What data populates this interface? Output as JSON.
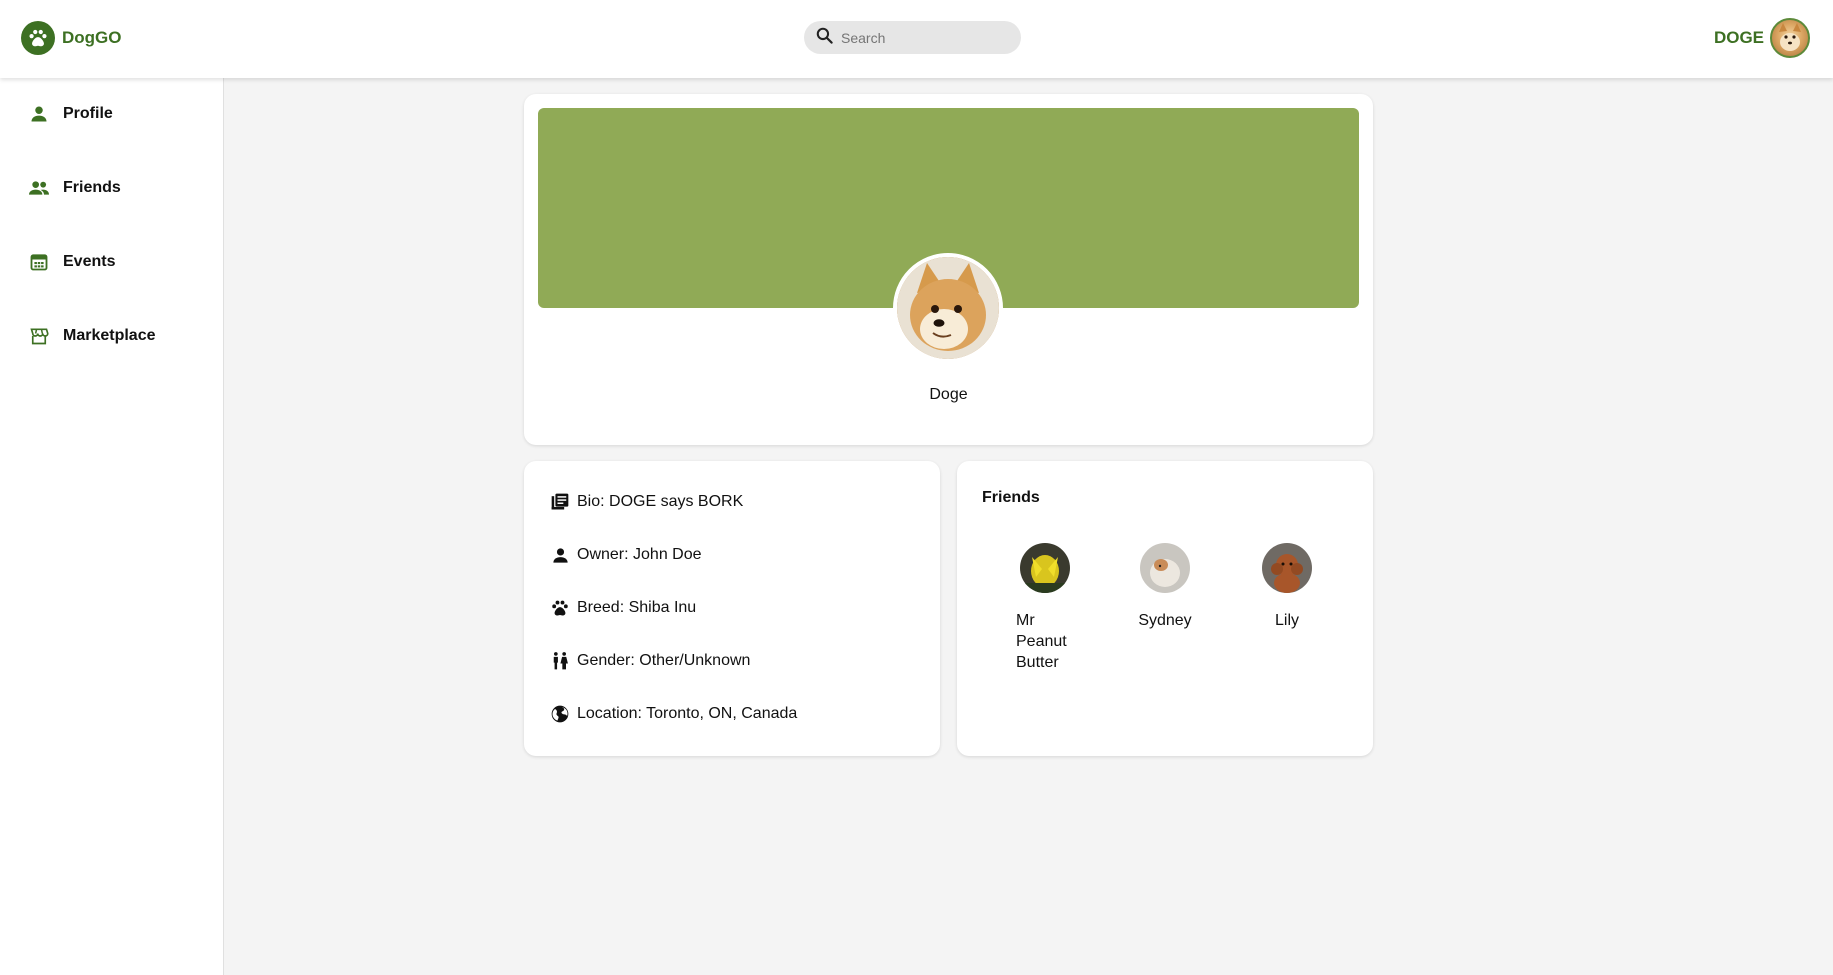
{
  "header": {
    "logo_text": "DogGO",
    "search_placeholder": "Search",
    "user_name": "DOGE"
  },
  "sidebar": {
    "items": [
      {
        "label": "Profile",
        "icon": "person-icon"
      },
      {
        "label": "Friends",
        "icon": "group-icon"
      },
      {
        "label": "Events",
        "icon": "calendar-icon"
      },
      {
        "label": "Marketplace",
        "icon": "storefront-icon"
      }
    ]
  },
  "profile": {
    "name": "Doge",
    "banner_color": "#90aa56"
  },
  "info": {
    "bio": "Bio: DOGE says BORK",
    "owner": "Owner: John Doe",
    "breed": "Breed: Shiba Inu",
    "gender": "Gender: Other/Unknown",
    "location": "Location: Toronto, ON, Canada"
  },
  "friends": {
    "title": "Friends",
    "items": [
      {
        "name": "Mr Peanut Butter"
      },
      {
        "name": "Sydney"
      },
      {
        "name": "Lily"
      }
    ]
  },
  "colors": {
    "brand": "#3d7023",
    "background": "#f4f4f4"
  }
}
